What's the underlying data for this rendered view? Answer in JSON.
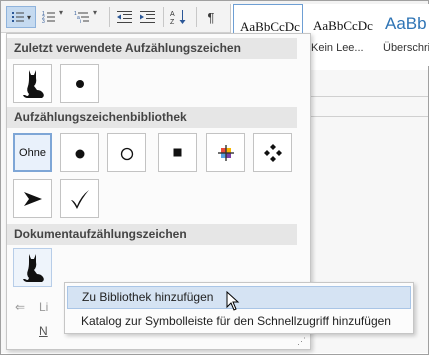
{
  "ribbon": {
    "buttons": [
      {
        "name": "bullets-button",
        "icon": "bullet-list-icon"
      },
      {
        "name": "numbering-button",
        "icon": "numbered-list-icon"
      },
      {
        "name": "multilevel-list-button",
        "icon": "multilevel-list-icon"
      },
      {
        "name": "decrease-indent-button",
        "icon": "decrease-indent-icon"
      },
      {
        "name": "increase-indent-button",
        "icon": "increase-indent-icon"
      },
      {
        "name": "sort-button",
        "icon": "sort-icon"
      },
      {
        "name": "show-formatting-button",
        "icon": "pilcrow-icon"
      }
    ],
    "pilcrow": "¶"
  },
  "styles_gallery": {
    "items": [
      {
        "preview": "AaBbCcDc",
        "name": ""
      },
      {
        "preview": "AaBbCcDc",
        "name": "Kein Lee..."
      },
      {
        "preview": "AaBb",
        "name": "Überschri"
      }
    ]
  },
  "panel": {
    "recent_header": "Zuletzt verwendete Aufzählungszeichen",
    "library_header": "Aufzählungszeichenbibliothek",
    "document_header": "Dokumentaufzählungszeichen",
    "recent": [
      {
        "icon": "cat-bullet-icon"
      },
      {
        "icon": "dot-bullet-icon"
      }
    ],
    "library": [
      {
        "icon": "none",
        "label": "Ohne",
        "selected": true
      },
      {
        "icon": "dot-bullet-icon",
        "glyph": "●"
      },
      {
        "icon": "circle-bullet-icon",
        "glyph": "○"
      },
      {
        "icon": "square-bullet-icon",
        "glyph": "■"
      },
      {
        "icon": "color-cross-bullet-icon"
      },
      {
        "icon": "diamond-bullet-icon",
        "glyph": "❖"
      },
      {
        "icon": "arrow-bullet-icon",
        "glyph": "➢"
      },
      {
        "icon": "checkmark-bullet-icon",
        "glyph": "✓"
      }
    ],
    "document": [
      {
        "icon": "cat-bullet-icon"
      }
    ],
    "partial_items": [
      "Li",
      "N"
    ]
  },
  "context_menu": {
    "items": [
      {
        "label": "Zu Bibliothek hinzufügen",
        "hover": true
      },
      {
        "label": "Katalog zur Symbolleiste für den Schnellzugriff hinzufügen",
        "hover": false
      }
    ]
  },
  "colors": {
    "accent": "#2e74b5",
    "hover": "#d5e3f3",
    "header_bg": "#e6e6e6"
  }
}
